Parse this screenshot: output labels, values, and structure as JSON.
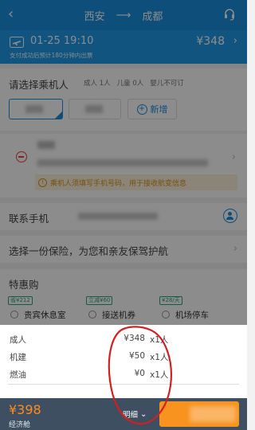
{
  "nav": {
    "from": "西安",
    "arrow": "⟶",
    "to": "成都",
    "back_glyph": "‹"
  },
  "flight": {
    "date_time": "01-25 19:10",
    "notice": "支付成功后预计180分钟内出票",
    "price": "¥348",
    "chevron": "›"
  },
  "passengers": {
    "title": "请选择乘机人",
    "adult": "成人 1人",
    "child": "儿童 0人",
    "infant": "婴儿不可订",
    "add_label": "新增",
    "warning": "乘机人须填写手机号码，用于接收航变信息"
  },
  "contact": {
    "label": "联系手机"
  },
  "insurance": {
    "label": "选择一份保险，为您和亲友保驾护航"
  },
  "deals": {
    "title": "特惠购",
    "items": [
      {
        "tag": "省¥212",
        "name": "贵宾休息室"
      },
      {
        "tag": "立减¥60",
        "name": "接送机券"
      },
      {
        "tag": "¥28/天",
        "name": "机场停车"
      }
    ]
  },
  "price_detail": {
    "rows": [
      {
        "name": "成人",
        "amount": "¥348",
        "qty": "x1人"
      },
      {
        "name": "机建",
        "amount": "¥50",
        "qty": "x1人"
      },
      {
        "name": "燃油",
        "amount": "¥0",
        "qty": "x1人"
      }
    ]
  },
  "bottom": {
    "total": "¥398",
    "cabin": "经济舱",
    "detail_label": "明细",
    "order_label": "下"
  },
  "colors": {
    "primary": "#1a8ee0",
    "accent_orange": "#f7931e",
    "warning": "#d9921a",
    "remove_red": "#e04545",
    "annotation_red": "#d41f1f"
  },
  "icons": {
    "back": "chevron-left-icon",
    "service": "headset-icon",
    "plane": "plane-icon",
    "add": "plus-circle-icon",
    "remove": "minus-circle-icon",
    "info": "info-icon",
    "contact": "contact-person-icon",
    "radio": "radio-icon"
  }
}
